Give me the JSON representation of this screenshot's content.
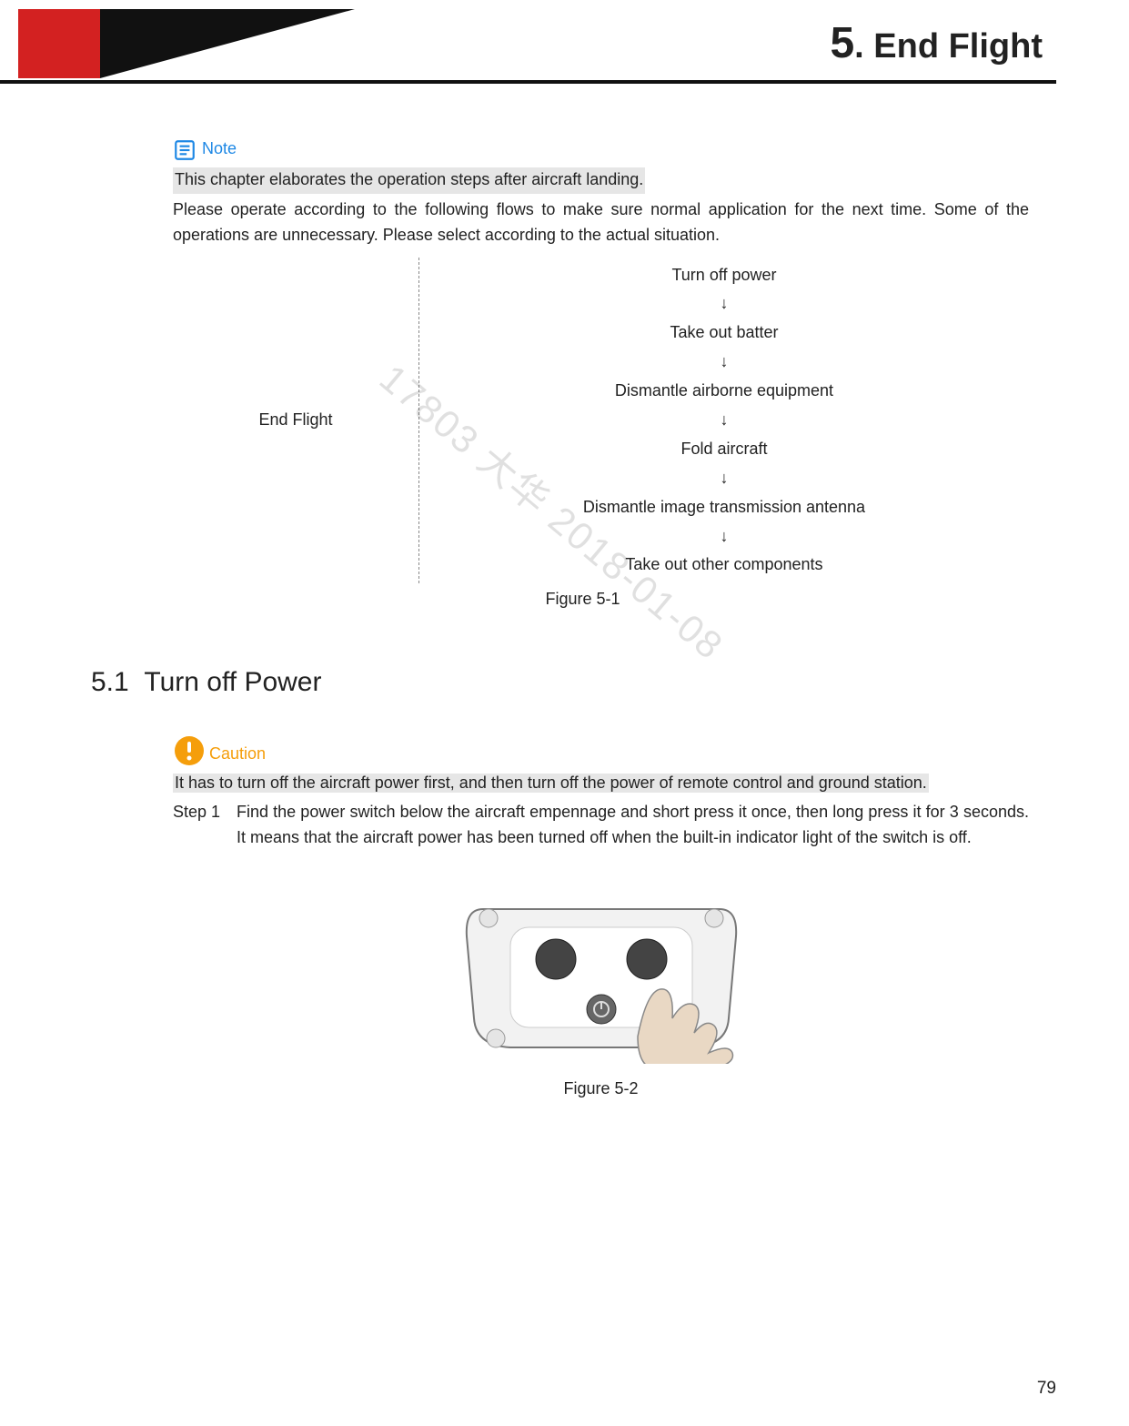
{
  "header": {
    "chapter_number": "5",
    "chapter_title": "End Flight"
  },
  "note": {
    "label": "Note",
    "highlight_text": "This chapter elaborates the operation steps after aircraft landing.",
    "body": "Please operate according to the following flows to make sure normal application for the next time. Some of the operations are unnecessary. Please select according to the actual situation."
  },
  "flow": {
    "left_label": "End Flight",
    "steps": [
      "Turn off power",
      "↓",
      "Take out batter",
      "↓",
      "Dismantle airborne equipment",
      "↓",
      "Fold aircraft",
      "↓",
      "Dismantle image transmission antenna",
      "↓",
      "Take out other components"
    ],
    "caption": "Figure 5-1"
  },
  "watermark": "17803 大华 2018-01-08",
  "section": {
    "number": "5.1",
    "title": "Turn off Power"
  },
  "caution": {
    "label": "Caution",
    "highlight_text": "It has to turn off the aircraft power first, and then turn off the power of remote control and ground station."
  },
  "step1": {
    "label": "Step 1",
    "text": "Find the power switch below the aircraft empennage and short press it once, then long press it for 3 seconds. It means that the aircraft power has been turned off when the built-in indicator light of the switch is off."
  },
  "figure2_caption": "Figure 5-2",
  "page_number": "79"
}
